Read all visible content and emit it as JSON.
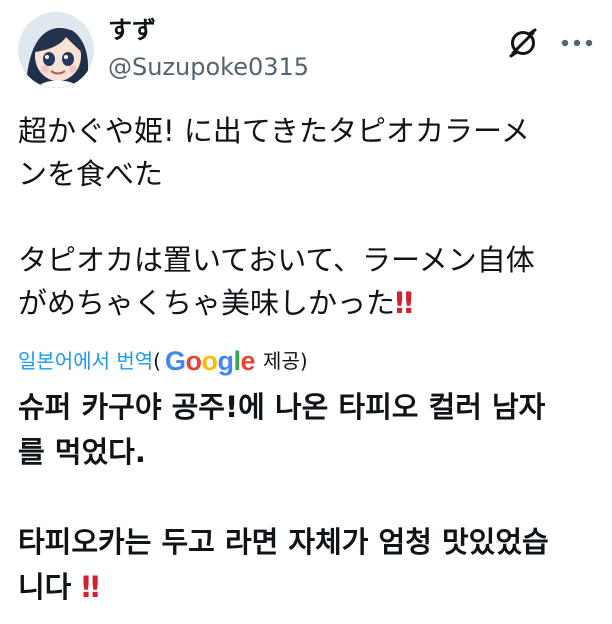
{
  "author": {
    "display_name": "すず",
    "handle": "@Suzupoke0315",
    "avatar": "avatar-anime-character"
  },
  "header_icons": {
    "no_icon": "prohibited-circle-icon",
    "more_icon": "more-horizontal-icon"
  },
  "tweet": {
    "line_1": "超かぐや姫! に出てきたタピオカラーメ",
    "line_2": "ンを食べた",
    "line_3": "タピオカは置いておいて、ラーメン自体",
    "line_4": "がめちゃくちゃ美味しかった",
    "emphasis": "‼"
  },
  "translation": {
    "link": "일본어에서 번역",
    "open_paren": "(",
    "provider_logo_text": "Google",
    "provided": "제공)",
    "line_1": "슈퍼 카구야 공주!에 나온 타피오 컬러 남자",
    "line_2": "를 먹었다.",
    "line_3": "타피오카는 두고 라면 자체가 엄청 맛있었습",
    "line_4": "니다",
    "emphasis": "‼"
  },
  "colors": {
    "text": "#0f1419",
    "secondary": "#536471",
    "link": "#1d9bf0",
    "emphasis": "#d71f2e"
  }
}
